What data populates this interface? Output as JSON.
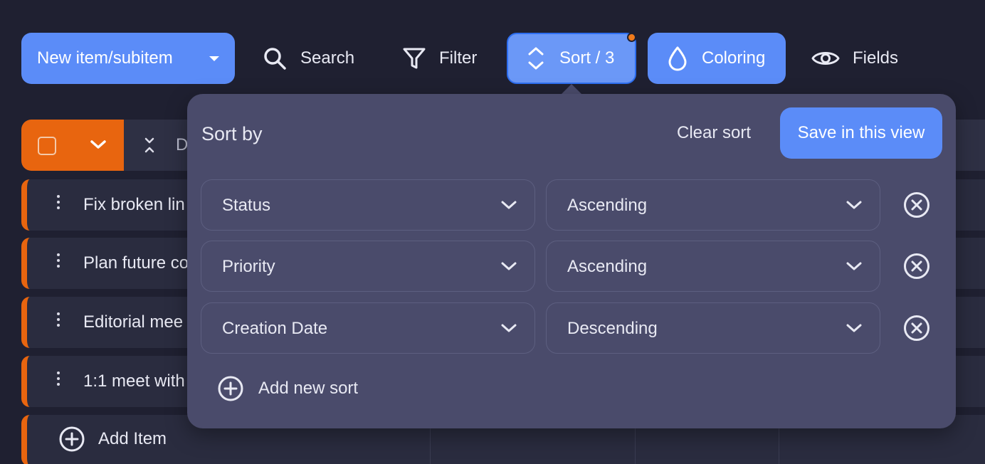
{
  "toolbar": {
    "new_item_label": "New item/subitem",
    "search_label": "Search",
    "filter_label": "Filter",
    "sort_label": "Sort / 3",
    "coloring_label": "Coloring",
    "fields_label": "Fields"
  },
  "table": {
    "header_partial": "D",
    "rows": [
      {
        "title": "Fix broken lin"
      },
      {
        "title": "Plan future co"
      },
      {
        "title": "Editorial mee"
      },
      {
        "title": "1:1 meet with"
      }
    ],
    "add_item_label": "Add Item"
  },
  "sort_panel": {
    "title": "Sort by",
    "clear_label": "Clear sort",
    "save_label": "Save in this view",
    "rules": [
      {
        "field": "Status",
        "direction": "Ascending"
      },
      {
        "field": "Priority",
        "direction": "Ascending"
      },
      {
        "field": "Creation Date",
        "direction": "Descending"
      }
    ],
    "add_label": "Add new sort"
  },
  "colors": {
    "accent": "#5b8cf8",
    "orange": "#e8650f",
    "panel": "#4a4b6b",
    "background": "#1f2031"
  }
}
